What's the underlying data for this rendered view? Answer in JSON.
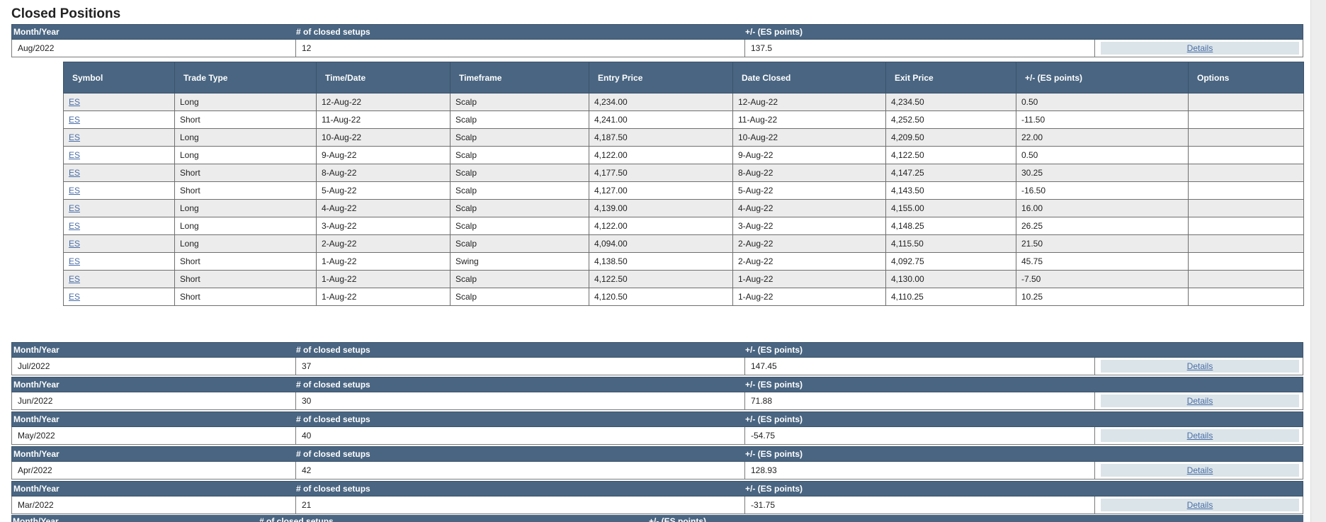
{
  "page_title": "Closed Positions",
  "summary_headers": {
    "month": "Month/Year",
    "count": "# of closed setups",
    "points": "+/- (ES points)"
  },
  "details_label": "Details",
  "months": [
    {
      "month": "Aug/2022",
      "count": "12",
      "points": "137.5"
    },
    {
      "month": "Jul/2022",
      "count": "37",
      "points": "147.45"
    },
    {
      "month": "Jun/2022",
      "count": "30",
      "points": "71.88"
    },
    {
      "month": "May/2022",
      "count": "40",
      "points": "-54.75"
    },
    {
      "month": "Apr/2022",
      "count": "42",
      "points": "128.93"
    },
    {
      "month": "Mar/2022",
      "count": "21",
      "points": "-31.75"
    }
  ],
  "detail_columns": [
    "Symbol",
    "Trade Type",
    "Time/Date",
    "Timeframe",
    "Entry Price",
    "Date Closed",
    "Exit Price",
    "+/- (ES points)",
    "Options"
  ],
  "trades": [
    {
      "symbol": "ES",
      "type": "Long",
      "time": "12-Aug-22",
      "timeframe": "Scalp",
      "entry": "4,234.00",
      "closed": "12-Aug-22",
      "exit": "4,234.50",
      "points": "0.50"
    },
    {
      "symbol": "ES",
      "type": "Short",
      "time": "11-Aug-22",
      "timeframe": "Scalp",
      "entry": "4,241.00",
      "closed": "11-Aug-22",
      "exit": "4,252.50",
      "points": "-11.50"
    },
    {
      "symbol": "ES",
      "type": "Long",
      "time": "10-Aug-22",
      "timeframe": "Scalp",
      "entry": "4,187.50",
      "closed": "10-Aug-22",
      "exit": "4,209.50",
      "points": "22.00"
    },
    {
      "symbol": "ES",
      "type": "Long",
      "time": "9-Aug-22",
      "timeframe": "Scalp",
      "entry": "4,122.00",
      "closed": "9-Aug-22",
      "exit": "4,122.50",
      "points": "0.50"
    },
    {
      "symbol": "ES",
      "type": "Short",
      "time": "8-Aug-22",
      "timeframe": "Scalp",
      "entry": "4,177.50",
      "closed": "8-Aug-22",
      "exit": "4,147.25",
      "points": "30.25"
    },
    {
      "symbol": "ES",
      "type": "Short",
      "time": "5-Aug-22",
      "timeframe": "Scalp",
      "entry": "4,127.00",
      "closed": "5-Aug-22",
      "exit": "4,143.50",
      "points": "-16.50"
    },
    {
      "symbol": "ES",
      "type": "Long",
      "time": "4-Aug-22",
      "timeframe": "Scalp",
      "entry": "4,139.00",
      "closed": "4-Aug-22",
      "exit": "4,155.00",
      "points": "16.00"
    },
    {
      "symbol": "ES",
      "type": "Long",
      "time": "3-Aug-22",
      "timeframe": "Scalp",
      "entry": "4,122.00",
      "closed": "3-Aug-22",
      "exit": "4,148.25",
      "points": "26.25"
    },
    {
      "symbol": "ES",
      "type": "Long",
      "time": "2-Aug-22",
      "timeframe": "Scalp",
      "entry": "4,094.00",
      "closed": "2-Aug-22",
      "exit": "4,115.50",
      "points": "21.50"
    },
    {
      "symbol": "ES",
      "type": "Short",
      "time": "1-Aug-22",
      "timeframe": "Swing",
      "entry": "4,138.50",
      "closed": "2-Aug-22",
      "exit": "4,092.75",
      "points": "45.75"
    },
    {
      "symbol": "ES",
      "type": "Short",
      "time": "1-Aug-22",
      "timeframe": "Scalp",
      "entry": "4,122.50",
      "closed": "1-Aug-22",
      "exit": "4,130.00",
      "points": "-7.50"
    },
    {
      "symbol": "ES",
      "type": "Short",
      "time": "1-Aug-22",
      "timeframe": "Scalp",
      "entry": "4,120.50",
      "closed": "1-Aug-22",
      "exit": "4,110.25",
      "points": "10.25"
    }
  ]
}
